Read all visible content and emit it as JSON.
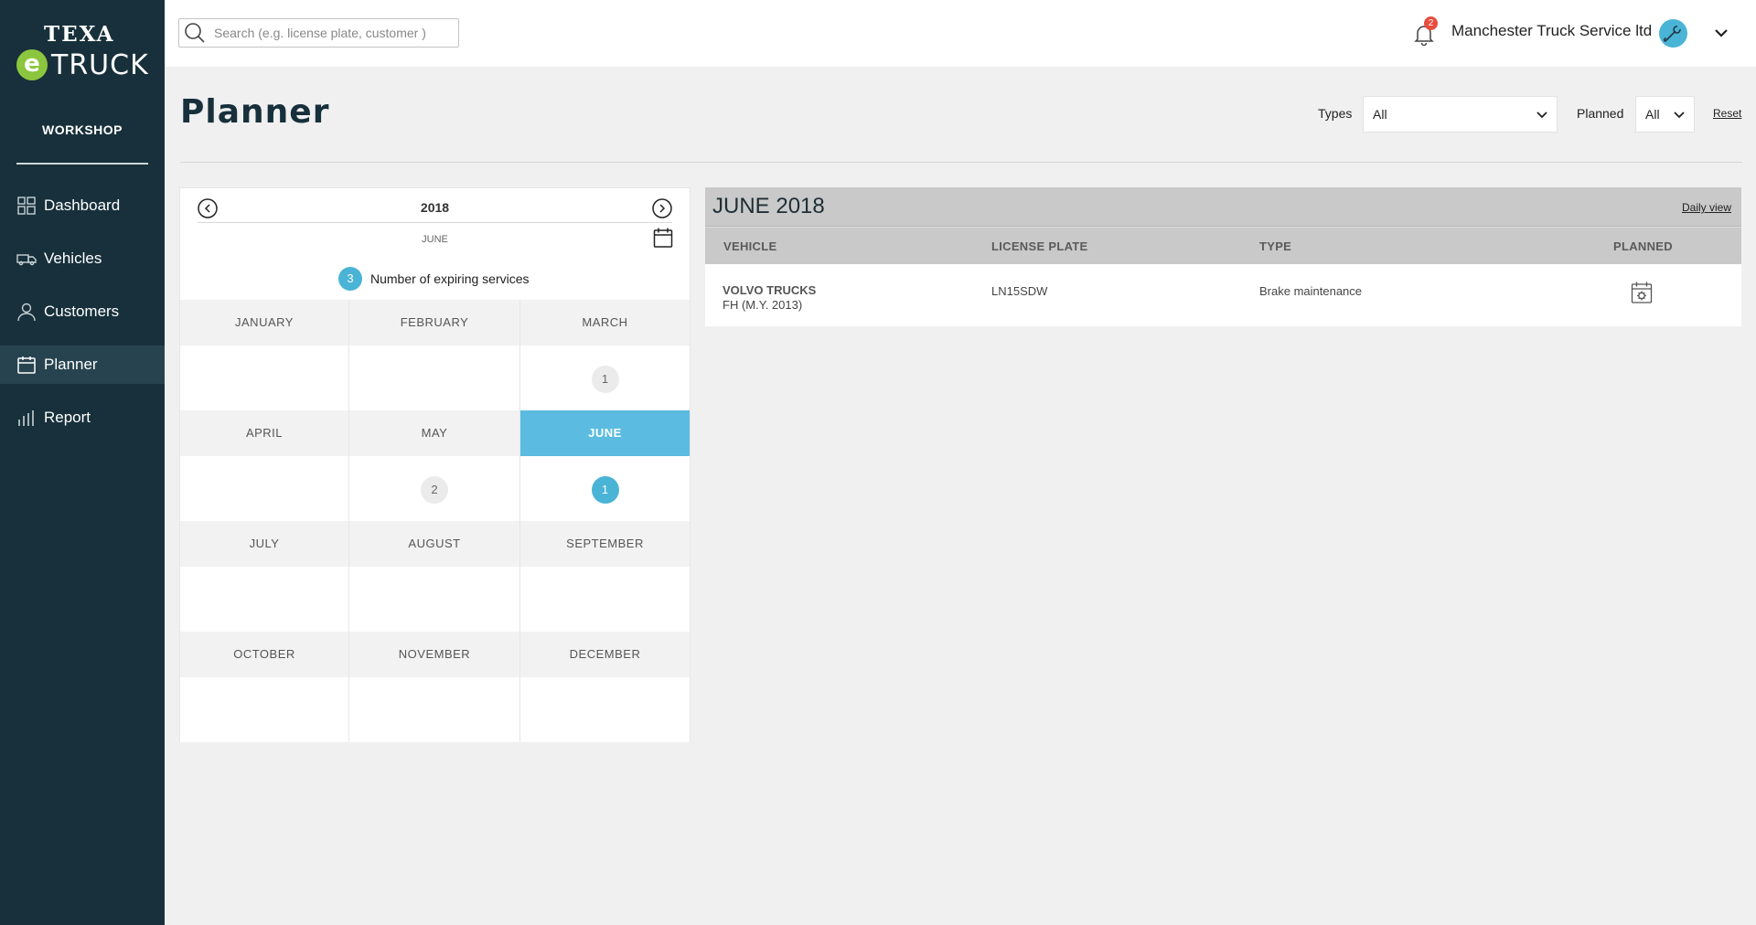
{
  "brand": {
    "top": "TEXA",
    "mark": "e",
    "bottom": "TRUCK"
  },
  "sidebar": {
    "section": "WORKSHOP",
    "items": [
      {
        "label": "Dashboard",
        "icon": "grid-icon"
      },
      {
        "label": "Vehicles",
        "icon": "truck-icon"
      },
      {
        "label": "Customers",
        "icon": "user-icon"
      },
      {
        "label": "Planner",
        "icon": "calendar-icon",
        "active": true
      },
      {
        "label": "Report",
        "icon": "bar-chart-icon"
      }
    ]
  },
  "header": {
    "search_placeholder": "Search (e.g. license plate, customer )",
    "notifications_count": "2",
    "company": "Manchester Truck Service ltd"
  },
  "page": {
    "title": "Planner",
    "filters": {
      "types_label": "Types",
      "types_value": "All",
      "planned_label": "Planned",
      "planned_value": "All",
      "reset": "Reset"
    }
  },
  "calendar": {
    "year": "2018",
    "selected_month": "JUNE",
    "legend_count": "3",
    "legend_text": "Number of expiring services",
    "months": [
      {
        "name": "JANUARY",
        "count": null
      },
      {
        "name": "FEBRUARY",
        "count": null
      },
      {
        "name": "MARCH",
        "count": "1"
      },
      {
        "name": "APRIL",
        "count": null
      },
      {
        "name": "MAY",
        "count": "2"
      },
      {
        "name": "JUNE",
        "count": "1",
        "active": true
      },
      {
        "name": "JULY",
        "count": null
      },
      {
        "name": "AUGUST",
        "count": null
      },
      {
        "name": "SEPTEMBER",
        "count": null
      },
      {
        "name": "OCTOBER",
        "count": null
      },
      {
        "name": "NOVEMBER",
        "count": null
      },
      {
        "name": "DECEMBER",
        "count": null
      }
    ]
  },
  "month_view": {
    "title": "JUNE 2018",
    "daily_view": "Daily view",
    "columns": [
      "VEHICLE",
      "LICENSE PLATE",
      "TYPE",
      "PLANNED"
    ],
    "rows": [
      {
        "vehicle": "VOLVO TRUCKS",
        "model": "FH (M.Y. 2013)",
        "plate": "LN15SDW",
        "type": "Brake maintenance",
        "planned_icon": "calendar-gear-icon"
      }
    ]
  },
  "colors": {
    "sidebar": "#17303b",
    "accent": "#4ab4d6",
    "brand_green": "#8cc63f",
    "badge_red": "#e84c3d"
  }
}
